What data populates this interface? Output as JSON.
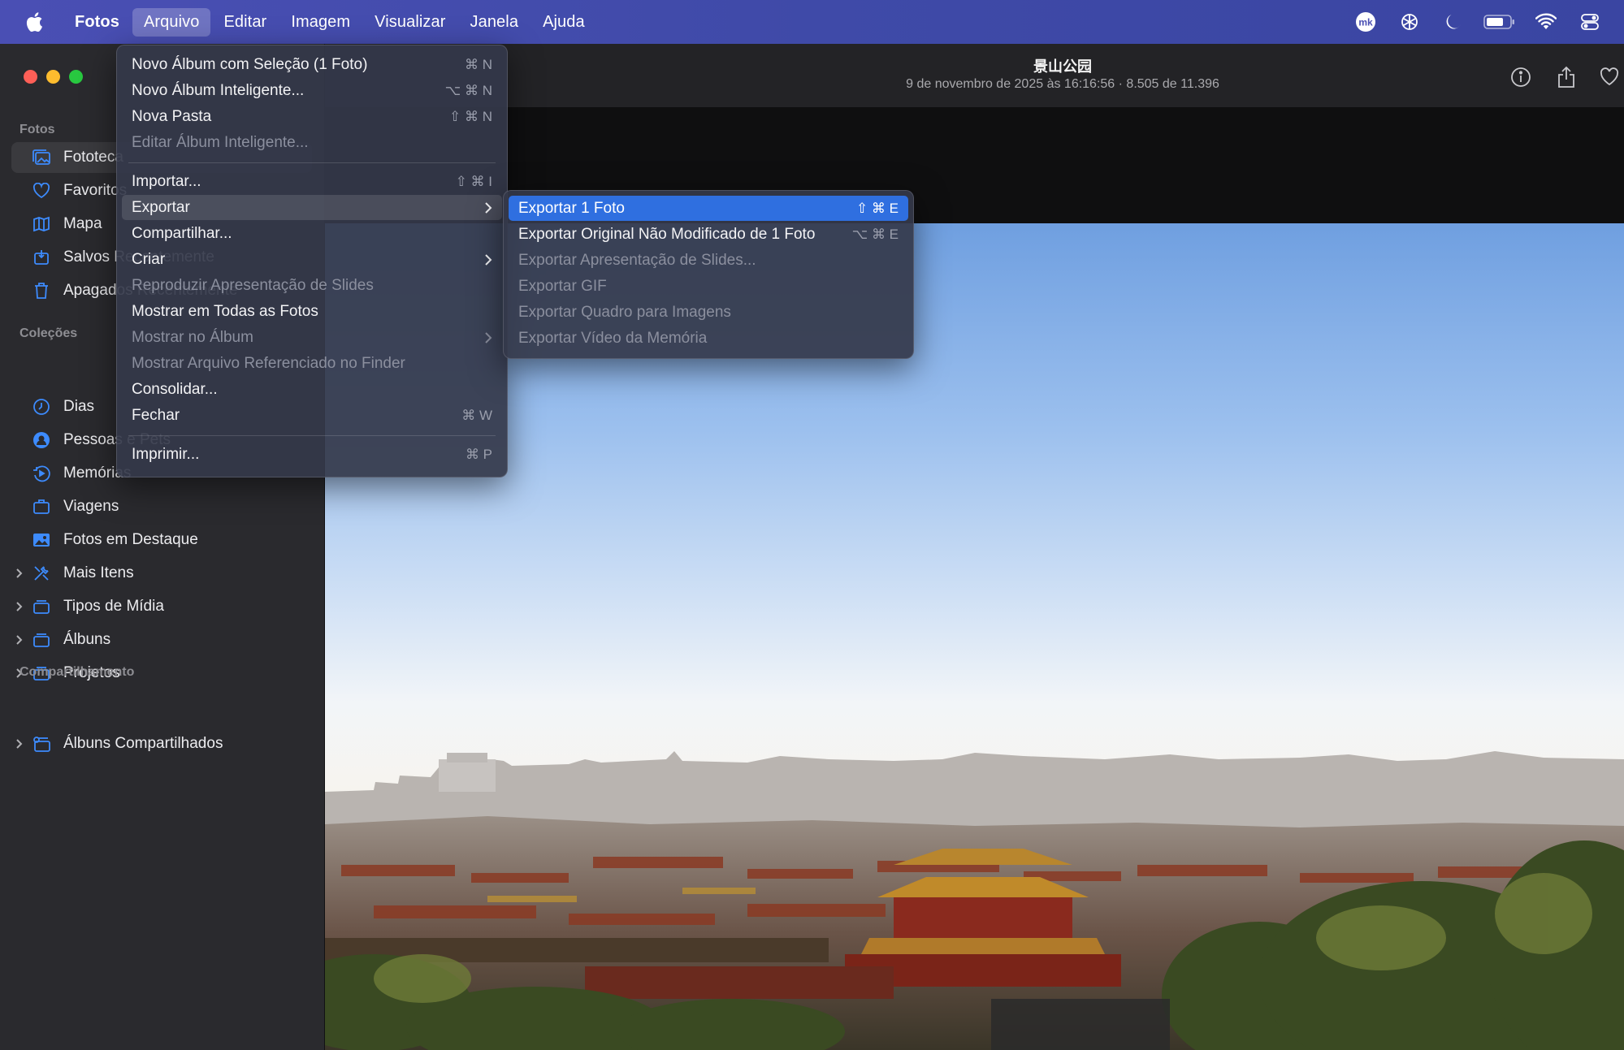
{
  "menubar": {
    "app_name": "Fotos",
    "menus": [
      "Arquivo",
      "Editar",
      "Imagem",
      "Visualizar",
      "Janela",
      "Ajuda"
    ],
    "active_menu": "Arquivo",
    "status_icons": [
      "mk-icon",
      "chatgpt-icon",
      "moon-icon",
      "battery-icon",
      "wifi-icon",
      "control-center-icon"
    ],
    "accent": "#4a4fb4"
  },
  "toolbar": {
    "photo_title": "景山公园",
    "photo_subtitle": "9 de novembro de 2025 às 16:16:56 · 8.505 de 11.396"
  },
  "sidebar": {
    "sections": [
      {
        "header": "Fotos"
      },
      {
        "header": "Coleções"
      },
      {
        "header": "Compartilhamento"
      }
    ],
    "items": [
      {
        "label": "Fototeca",
        "icon": "photo-library-icon",
        "selected": true
      },
      {
        "label": "Favoritos",
        "icon": "heart-icon"
      },
      {
        "label": "Mapa",
        "icon": "map-icon"
      },
      {
        "label": "Salvos Recentemente",
        "icon": "saved-icon"
      },
      {
        "label": "Apagados Recentemente",
        "icon": "trash-icon"
      },
      {
        "label": "Dias",
        "icon": "clock-icon"
      },
      {
        "label": "Pessoas e Pets",
        "icon": "person-icon"
      },
      {
        "label": "Memórias",
        "icon": "memories-icon"
      },
      {
        "label": "Viagens",
        "icon": "suitcase-icon"
      },
      {
        "label": "Fotos em Destaque",
        "icon": "featured-icon"
      },
      {
        "label": "Mais Itens",
        "icon": "tools-icon"
      },
      {
        "label": "Tipos de Mídia",
        "icon": "folder-icon"
      },
      {
        "label": "Álbuns",
        "icon": "folder-icon"
      },
      {
        "label": "Projetos",
        "icon": "folder-icon"
      },
      {
        "label": "Álbuns Compartilhados",
        "icon": "shared-albums-icon"
      }
    ]
  },
  "file_menu": {
    "items": [
      {
        "label": "Novo Álbum com Seleção (1 Foto)",
        "shortcut": "⌘ N",
        "enabled": true
      },
      {
        "label": "Novo Álbum Inteligente...",
        "shortcut": "⌥ ⌘ N",
        "enabled": true
      },
      {
        "label": "Nova Pasta",
        "shortcut": "⇧ ⌘ N",
        "enabled": true
      },
      {
        "label": "Editar Álbum Inteligente...",
        "shortcut": "",
        "enabled": false
      },
      {
        "label": "Importar...",
        "shortcut": "⇧ ⌘ I",
        "enabled": true
      },
      {
        "label": "Exportar",
        "shortcut": "",
        "enabled": true,
        "submenu": true
      },
      {
        "label": "Compartilhar...",
        "shortcut": "",
        "enabled": true
      },
      {
        "label": "Criar",
        "shortcut": "",
        "enabled": true,
        "submenu": true
      },
      {
        "label": "Reproduzir Apresentação de Slides",
        "shortcut": "",
        "enabled": false
      },
      {
        "label": "Mostrar em Todas as Fotos",
        "shortcut": "",
        "enabled": true
      },
      {
        "label": "Mostrar no Álbum",
        "shortcut": "",
        "enabled": false,
        "submenu": true
      },
      {
        "label": "Mostrar Arquivo Referenciado no Finder",
        "shortcut": "",
        "enabled": false
      },
      {
        "label": "Consolidar...",
        "shortcut": "",
        "enabled": true
      },
      {
        "label": "Fechar",
        "shortcut": "⌘ W",
        "enabled": true
      },
      {
        "label": "Imprimir...",
        "shortcut": "⌘ P",
        "enabled": true
      }
    ]
  },
  "export_submenu": {
    "items": [
      {
        "label": "Exportar 1 Foto",
        "shortcut": "⇧ ⌘ E",
        "enabled": true,
        "highlighted": true
      },
      {
        "label": "Exportar Original Não Modificado de 1 Foto",
        "shortcut": "⌥ ⌘ E",
        "enabled": true
      },
      {
        "label": "Exportar Apresentação de Slides...",
        "shortcut": "",
        "enabled": false
      },
      {
        "label": "Exportar GIF",
        "shortcut": "",
        "enabled": false
      },
      {
        "label": "Exportar Quadro para Imagens",
        "shortcut": "",
        "enabled": false
      },
      {
        "label": "Exportar Vídeo da Memória",
        "shortcut": "",
        "enabled": false
      }
    ]
  }
}
